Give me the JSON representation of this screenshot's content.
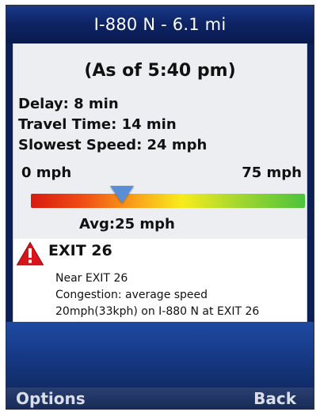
{
  "header": {
    "title": "I-880 N - 6.1 mi"
  },
  "summary": {
    "as_of": "(As of 5:40 pm)",
    "delay": "Delay: 8 min",
    "travel_time": "Travel Time: 14 min",
    "slowest_speed": "Slowest Speed: 24 mph"
  },
  "speed_scale": {
    "min_label": "0 mph",
    "max_label": "75 mph",
    "min_value": 0,
    "max_value": 75,
    "avg_value": 25,
    "avg_label": "Avg:25 mph"
  },
  "incident": {
    "icon": "warning-triangle-icon",
    "title": "EXIT 26",
    "lines": [
      "Near EXIT 26",
      "Congestion: average speed",
      "20mph(33kph) on I-880 N at EXIT 26"
    ]
  },
  "softkeys": {
    "left": "Options",
    "right": "Back"
  }
}
